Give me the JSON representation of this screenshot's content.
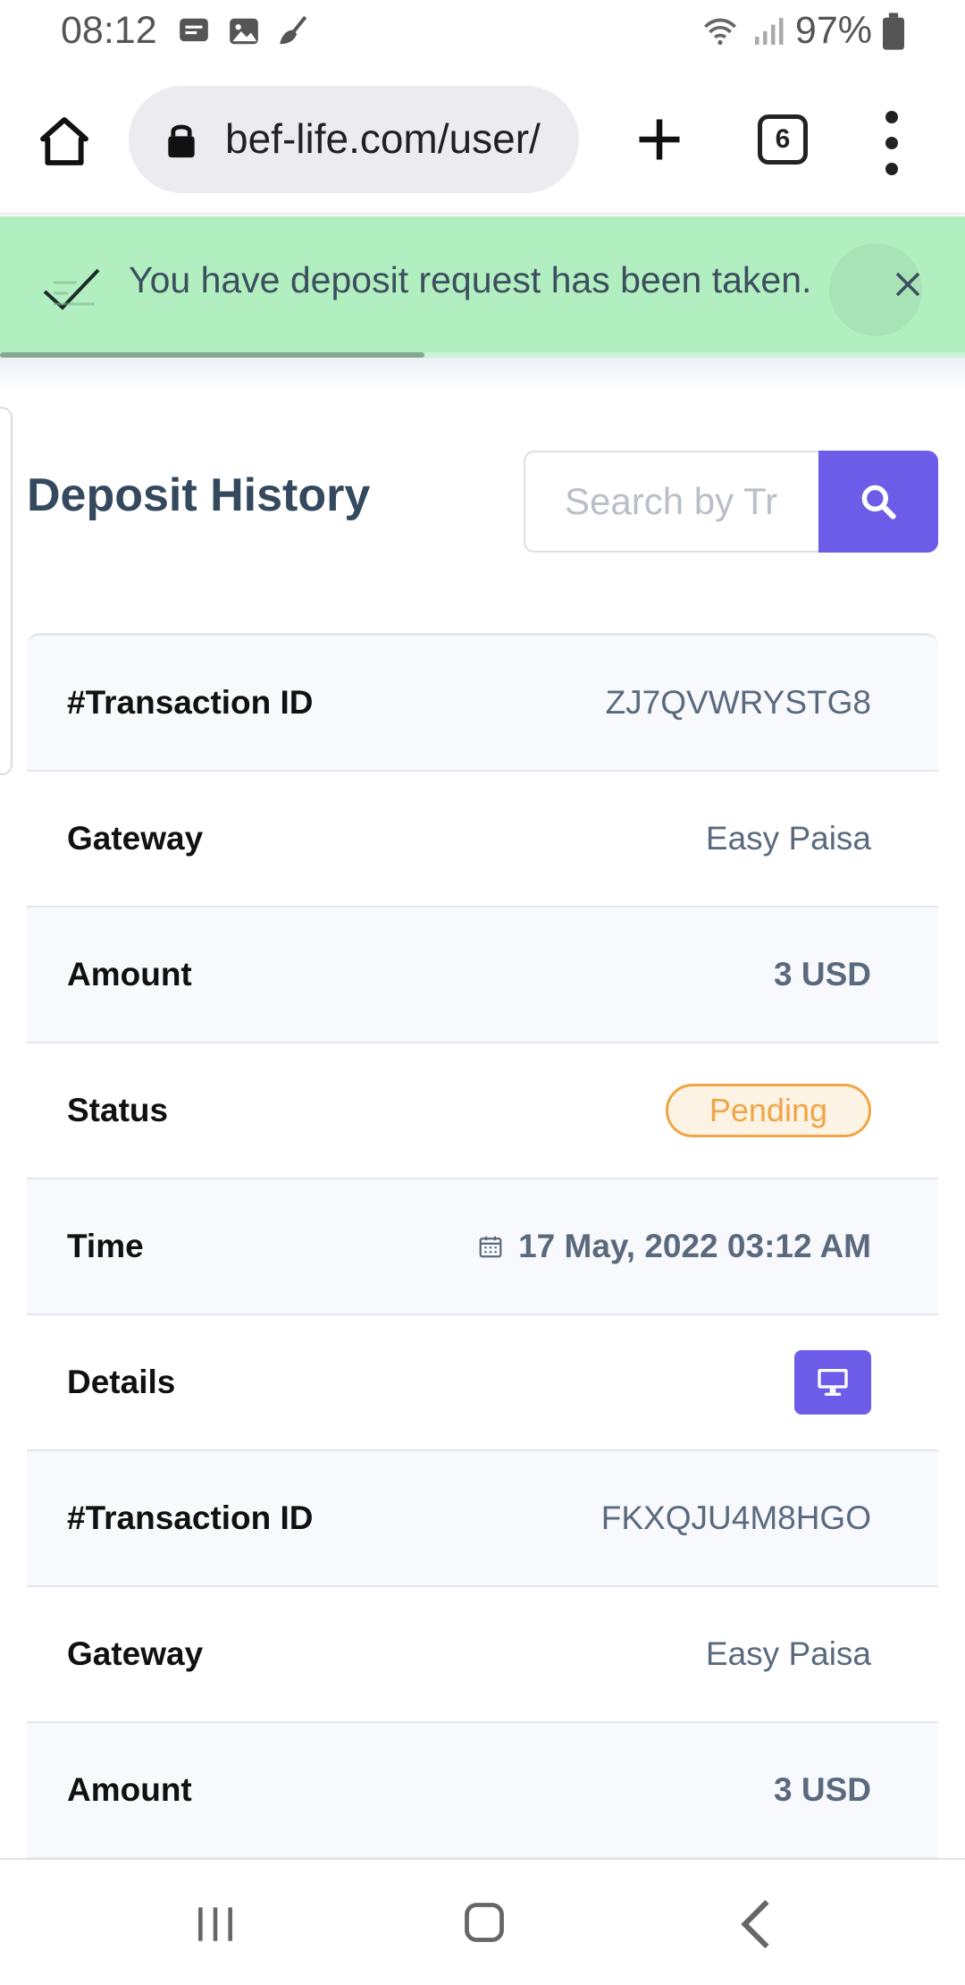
{
  "status_bar": {
    "time": "08:12",
    "battery": "97%",
    "icons": [
      "message-icon",
      "image-icon",
      "broom-icon",
      "wifi-icon",
      "signal-icon",
      "battery-icon"
    ]
  },
  "browser": {
    "url": "bef-life.com/user/",
    "tab_count": "6"
  },
  "toast": {
    "message": "You have deposit request has been taken.",
    "progress": 0.44,
    "color": "#b2efc0"
  },
  "page": {
    "title": "Deposit History",
    "search_placeholder": "Search by Transaction ID"
  },
  "transactions": [
    {
      "transaction_id_label": "#Transaction ID",
      "transaction_id": "ZJ7QVWRYSTG8",
      "gateway_label": "Gateway",
      "gateway": "Easy Paisa",
      "amount_label": "Amount",
      "amount": "3 USD",
      "status_label": "Status",
      "status": "Pending",
      "time_label": "Time",
      "time": "17 May, 2022 03:12 AM",
      "details_label": "Details"
    },
    {
      "transaction_id_label": "#Transaction ID",
      "transaction_id": "FKXQJU4M8HGO",
      "gateway_label": "Gateway",
      "gateway": "Easy Paisa",
      "amount_label": "Amount",
      "amount": "3 USD"
    }
  ],
  "colors": {
    "accent": "#6c5ce7",
    "pending": "#f0a545",
    "title": "#34495e"
  }
}
